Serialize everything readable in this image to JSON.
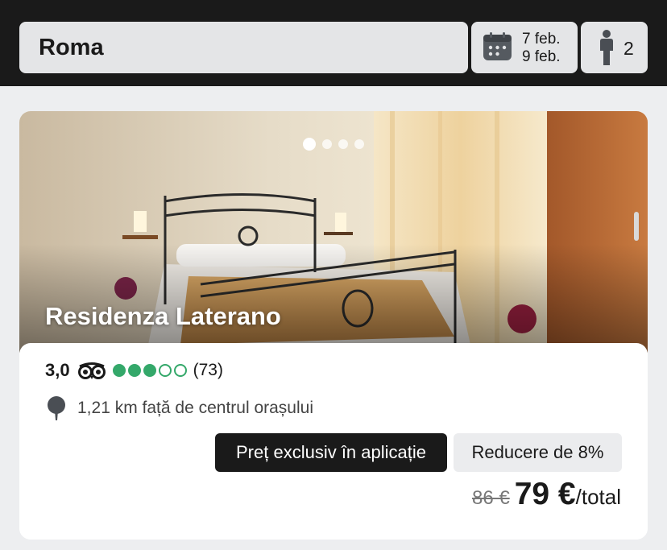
{
  "search": {
    "city": "Roma"
  },
  "dates": {
    "checkin": "7 feb.",
    "checkout": "9 feb.",
    "icon": "calendar-icon"
  },
  "guests": {
    "count": "2",
    "icon": "person-icon"
  },
  "hotel": {
    "name": "Residenza Laterano",
    "photo_dots": 4,
    "photo_active_index": 0,
    "rating": {
      "score": "3,0",
      "bubbles_filled": 3,
      "bubbles_total": 5,
      "reviews": "(73)",
      "icon": "tripadvisor-owl-icon",
      "bubble_color": "#34a86a"
    },
    "distance": "1,21 km față de centrul orașului",
    "badge_exclusive": "Preț exclusiv în aplicație",
    "badge_discount": "Reducere de 8%",
    "old_price": "86 €",
    "new_price": "79 €",
    "price_suffix": "/total"
  },
  "colors": {
    "topbar": "#1a1a1a",
    "page_bg": "#edeef0",
    "rating_green": "#34a86a"
  }
}
